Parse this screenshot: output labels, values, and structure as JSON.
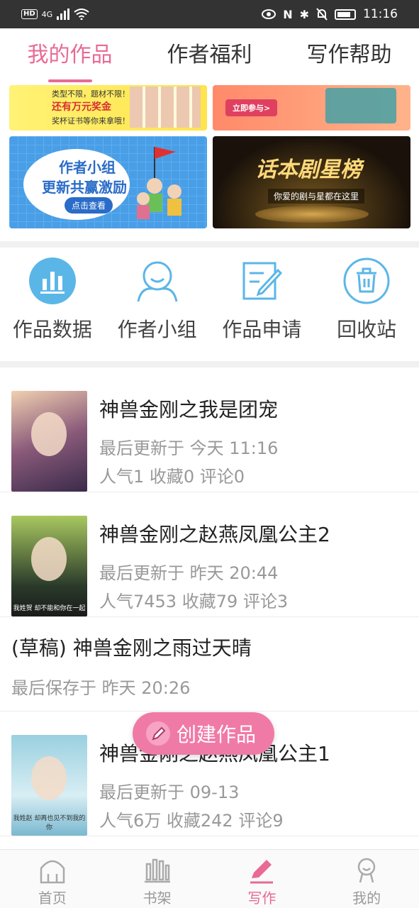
{
  "status_bar": {
    "left": [
      "HD",
      "4G"
    ],
    "time": "11:16"
  },
  "tabs": [
    {
      "label": "我的作品",
      "active": true
    },
    {
      "label": "作者福利",
      "active": false
    },
    {
      "label": "写作帮助",
      "active": false
    }
  ],
  "banners": {
    "b1": {
      "line1": "类型不限，题材不限！",
      "line2": "还有万元奖金",
      "line3": "奖杯证书等你来拿哦！"
    },
    "b2": {
      "button": "立即参与>"
    },
    "b3": {
      "line1": "作者小组",
      "line2": "更新共赢激励",
      "button": "点击查看"
    },
    "b4": {
      "title": "话本剧星榜",
      "subtitle": "你爱的剧与星都在这里"
    }
  },
  "actions": [
    {
      "label": "作品数据",
      "icon": "bar-chart-icon"
    },
    {
      "label": "作者小组",
      "icon": "group-icon"
    },
    {
      "label": "作品申请",
      "icon": "edit-doc-icon"
    },
    {
      "label": "回收站",
      "icon": "trash-icon"
    }
  ],
  "works": [
    {
      "title": "神兽金刚之我是团宠",
      "updated": "最后更新于 今天 11:16",
      "stats": "人气1 收藏0 评论0"
    },
    {
      "title": "神兽金刚之赵燕凤凰公主2",
      "updated": "最后更新于 昨天 20:44",
      "stats": "人气7453 收藏79 评论3",
      "cover_caption": "我姓贺 却不能和你在一起"
    },
    {
      "title": "(草稿) 神兽金刚之雨过天晴",
      "updated": "最后保存于 昨天 20:26"
    },
    {
      "title": "神兽金刚之赵燕凤凰公主1",
      "updated": "最后更新于 09-13",
      "stats": "人气6万 收藏242 评论9",
      "cover_caption": "我姓赵 却再也见不到我的你"
    }
  ],
  "fab": {
    "label": "创建作品"
  },
  "bottom_nav": [
    {
      "label": "首页",
      "icon": "home-icon",
      "active": false
    },
    {
      "label": "书架",
      "icon": "bookshelf-icon",
      "active": false
    },
    {
      "label": "写作",
      "icon": "pen-icon",
      "active": true
    },
    {
      "label": "我的",
      "icon": "profile-icon",
      "active": false
    }
  ],
  "colors": {
    "accent": "#e86a95",
    "fab": "#f07aa6",
    "icon_blue": "#5bb6e8",
    "status_bar": "#333333"
  }
}
